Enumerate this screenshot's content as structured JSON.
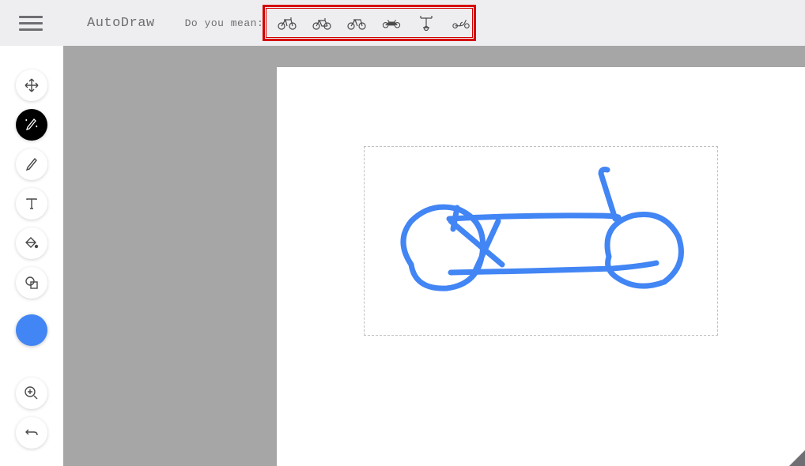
{
  "app": {
    "title": "AutoDraw"
  },
  "header": {
    "prompt": "Do you mean:"
  },
  "suggestions": [
    {
      "name": "bicycle-1"
    },
    {
      "name": "bicycle-2"
    },
    {
      "name": "bicycle-3"
    },
    {
      "name": "motorcycle"
    },
    {
      "name": "bike-front"
    },
    {
      "name": "scooter"
    }
  ],
  "tools": [
    {
      "name": "select",
      "active": false
    },
    {
      "name": "autodraw",
      "active": true
    },
    {
      "name": "draw",
      "active": false
    },
    {
      "name": "type",
      "active": false
    },
    {
      "name": "fill",
      "active": false
    },
    {
      "name": "shape",
      "active": false
    }
  ],
  "color": {
    "current": "#4285f4"
  },
  "canvas": {
    "drawing_description": "hand-drawn bicycle sketch",
    "stroke_color": "#4285f4",
    "selection": {
      "visible": true
    }
  }
}
